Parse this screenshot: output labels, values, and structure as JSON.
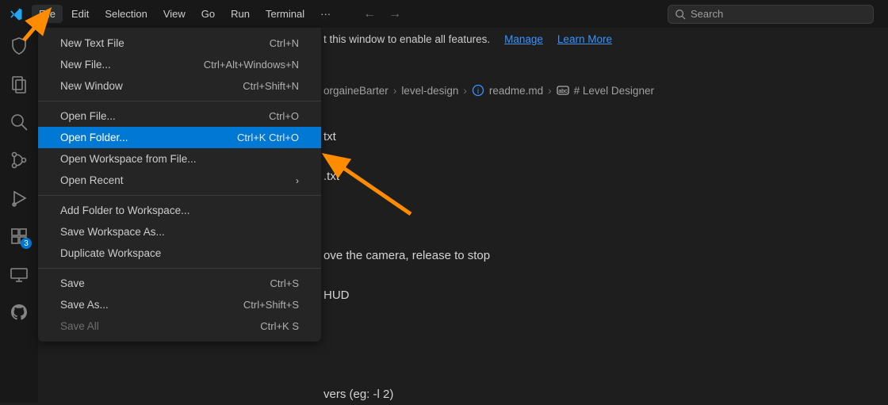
{
  "menubar": [
    "File",
    "Edit",
    "Selection",
    "View",
    "Go",
    "Run",
    "Terminal"
  ],
  "menubar_active_index": 0,
  "search_placeholder": "Search",
  "infobar": {
    "text": "t this window to enable all features.",
    "link_manage": "Manage",
    "link_learn": "Learn More"
  },
  "breadcrumb": {
    "p1": "orgaineBarter",
    "p2": "level-design",
    "p3": "readme.md",
    "p4": "# Level Designer"
  },
  "editor_lines": [
    "txt",
    "",
    ".txt",
    "",
    "",
    "",
    "ove the camera, release to stop",
    "",
    "HUD",
    "",
    "",
    "",
    "",
    "vers (eg: -l 2)"
  ],
  "activity_badge": "3",
  "dropdown": {
    "g1": [
      {
        "label": "New Text File",
        "shortcut": "Ctrl+N"
      },
      {
        "label": "New File...",
        "shortcut": "Ctrl+Alt+Windows+N"
      },
      {
        "label": "New Window",
        "shortcut": "Ctrl+Shift+N"
      }
    ],
    "g2": [
      {
        "label": "Open File...",
        "shortcut": "Ctrl+O"
      },
      {
        "label": "Open Folder...",
        "shortcut": "Ctrl+K Ctrl+O",
        "selected": true
      },
      {
        "label": "Open Workspace from File...",
        "shortcut": ""
      },
      {
        "label": "Open Recent",
        "shortcut": "",
        "submenu": true
      }
    ],
    "g3": [
      {
        "label": "Add Folder to Workspace...",
        "shortcut": ""
      },
      {
        "label": "Save Workspace As...",
        "shortcut": ""
      },
      {
        "label": "Duplicate Workspace",
        "shortcut": ""
      }
    ],
    "g4": [
      {
        "label": "Save",
        "shortcut": "Ctrl+S"
      },
      {
        "label": "Save As...",
        "shortcut": "Ctrl+Shift+S"
      },
      {
        "label": "Save All",
        "shortcut": "Ctrl+K S",
        "disabled": true
      }
    ]
  }
}
